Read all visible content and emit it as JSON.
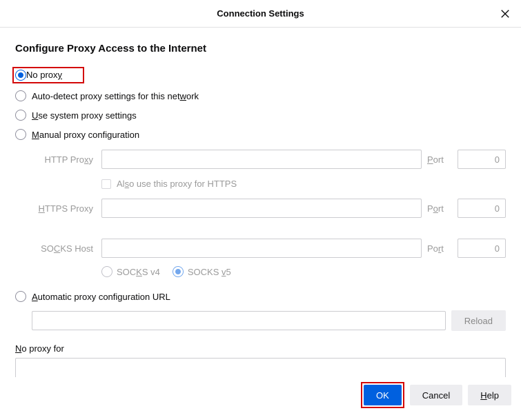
{
  "title": "Connection Settings",
  "heading": "Configure Proxy Access to the Internet",
  "radios": {
    "no_proxy": "No proxy",
    "no_proxy_accel": "y",
    "auto_detect": "Auto-detect proxy settings for this network",
    "auto_detect_accel": "w",
    "system": "Use system proxy settings",
    "system_accel": "U",
    "manual": "Manual proxy configuration",
    "manual_accel": "M",
    "auto_url": "Automatic proxy configuration URL",
    "auto_url_accel": "A",
    "selected": "no_proxy"
  },
  "manual": {
    "http_label": "HTTP Proxy",
    "http_accel": "x",
    "http_value": "",
    "http_port": "0",
    "also_https": "Also use this proxy for HTTPS",
    "also_https_accel": "s",
    "https_label": "HTTPS Proxy",
    "https_accel": "H",
    "https_value": "",
    "https_port": "0",
    "socks_label": "SOCKS Host",
    "socks_accel": "C",
    "socks_value": "",
    "socks_port": "0",
    "port_label": "Port",
    "port_accel": "P",
    "socks_v4": "SOCKS v4",
    "socks_v4_accel": "K",
    "socks_v5": "SOCKS v5",
    "socks_v5_accel": "v",
    "socks_selected": "v5"
  },
  "auto_url_value": "",
  "reload_label": "Reload",
  "noproxy_label": "No proxy for",
  "noproxy_accel": "N",
  "noproxy_value": "",
  "buttons": {
    "ok": "OK",
    "cancel": "Cancel",
    "help": "Help",
    "help_accel": "H"
  }
}
